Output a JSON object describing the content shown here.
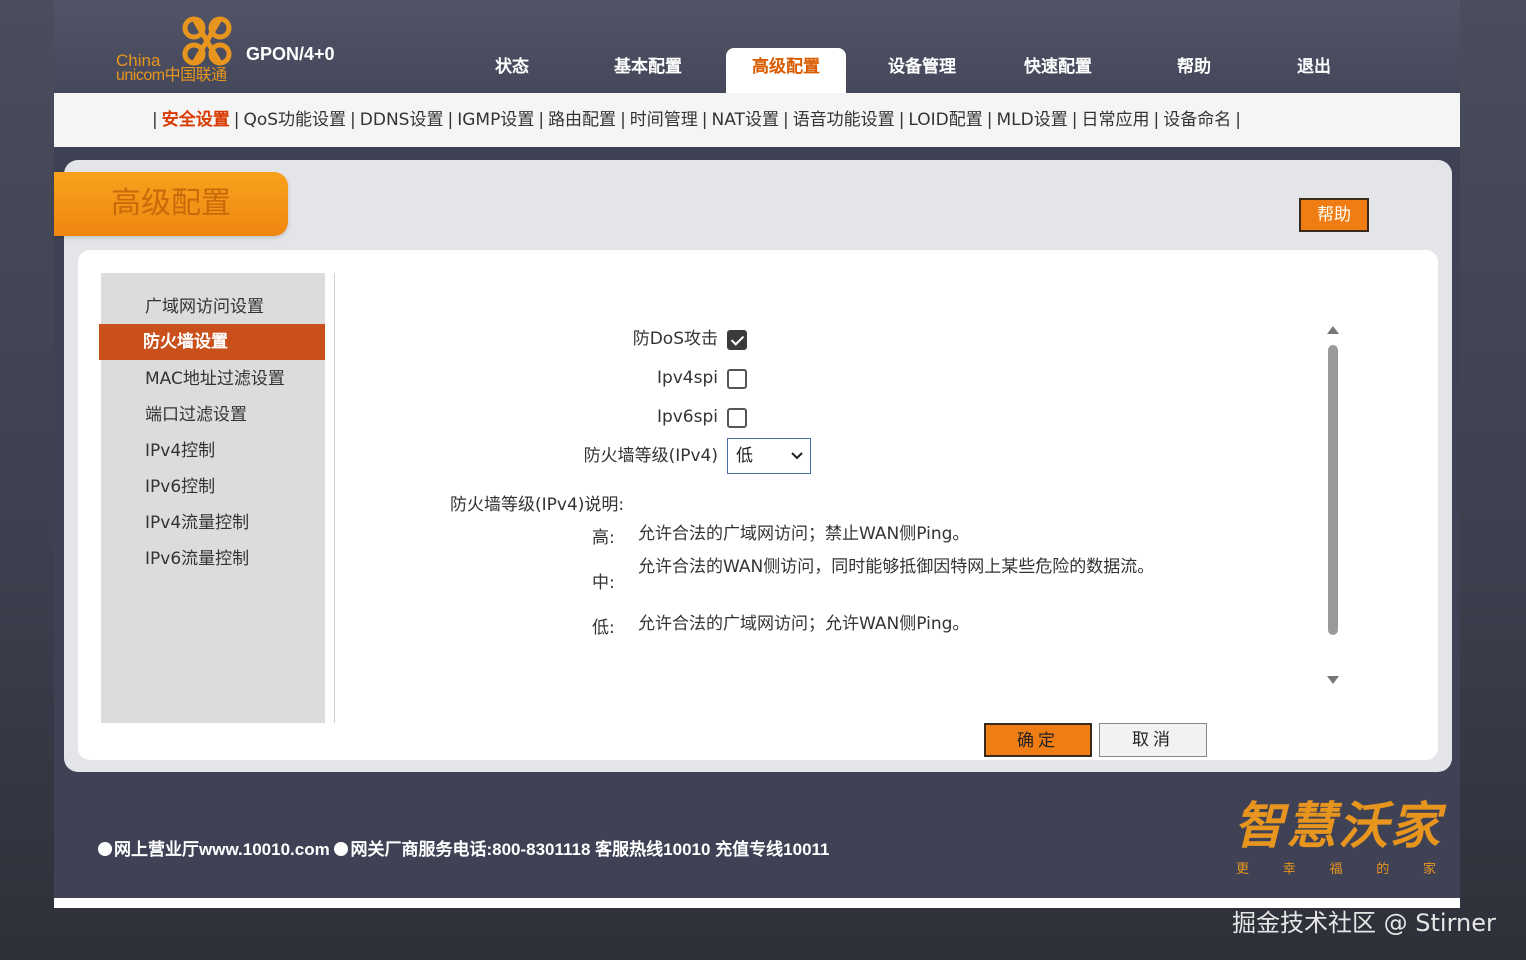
{
  "brand": {
    "logo_text_1": "China",
    "logo_text_2": "unicom中国联通",
    "model": "GPON/4+0"
  },
  "main_nav": [
    {
      "label": "状态",
      "active": false
    },
    {
      "label": "基本配置",
      "active": false
    },
    {
      "label": "高级配置",
      "active": true
    },
    {
      "label": "设备管理",
      "active": false
    },
    {
      "label": "快速配置",
      "active": false
    },
    {
      "label": "帮助",
      "active": false
    },
    {
      "label": "退出",
      "active": false
    }
  ],
  "sub_nav": [
    {
      "label": "安全设置",
      "active": true
    },
    {
      "label": "QoS功能设置",
      "active": false
    },
    {
      "label": "DDNS设置",
      "active": false
    },
    {
      "label": "IGMP设置",
      "active": false
    },
    {
      "label": "路由配置",
      "active": false
    },
    {
      "label": "时间管理",
      "active": false
    },
    {
      "label": "NAT设置",
      "active": false
    },
    {
      "label": "语音功能设置",
      "active": false
    },
    {
      "label": "LOID配置",
      "active": false
    },
    {
      "label": "MLD设置",
      "active": false
    },
    {
      "label": "日常应用",
      "active": false
    },
    {
      "label": "设备命名",
      "active": false
    }
  ],
  "sub_nav_separator": "|",
  "section_title": "高级配置",
  "help_button": "帮助",
  "sidebar": [
    {
      "label": "广域网访问设置",
      "active": false
    },
    {
      "label": "防火墙设置",
      "active": true
    },
    {
      "label": "MAC地址过滤设置",
      "active": false
    },
    {
      "label": "端口过滤设置",
      "active": false
    },
    {
      "label": "IPv4控制",
      "active": false
    },
    {
      "label": "IPv6控制",
      "active": false
    },
    {
      "label": "IPv4流量控制",
      "active": false
    },
    {
      "label": "IPv6流量控制",
      "active": false
    }
  ],
  "form": {
    "dos_label": "防DoS攻击",
    "dos_checked": true,
    "ipv4spi_label": "Ipv4spi",
    "ipv4spi_checked": false,
    "ipv6spi_label": "Ipv6spi",
    "ipv6spi_checked": false,
    "level_label": "防火墙等级(IPv4)",
    "level_value": "低"
  },
  "description": {
    "title": "防火墙等级(IPv4)说明:",
    "high_key": "高:",
    "high_text": "允许合法的广域网访问；禁止WAN侧Ping。",
    "mid_key": "中:",
    "mid_text": "允许合法的WAN侧访问，同时能够抵御因特网上某些危险的数据流。",
    "low_key": "低:",
    "low_text": "允许合法的广域网访问；允许WAN侧Ping。"
  },
  "buttons": {
    "ok": "确定",
    "cancel": "取消"
  },
  "footer": {
    "text_1": "网上营业厅www.10010.com",
    "text_2": "网关厂商服务电话:800-8301118 客服热线10010 充值专线10011",
    "brand_main": "智慧沃家",
    "brand_sub": [
      "更",
      "幸",
      "福",
      "的",
      "家"
    ]
  },
  "watermark": "掘金技术社区 @ Stirner",
  "colors": {
    "accent_orange": "#ef7d14",
    "active_sidebar": "#c9501a",
    "active_nav_text": "#d85b00",
    "header_bg": "#44485a"
  }
}
